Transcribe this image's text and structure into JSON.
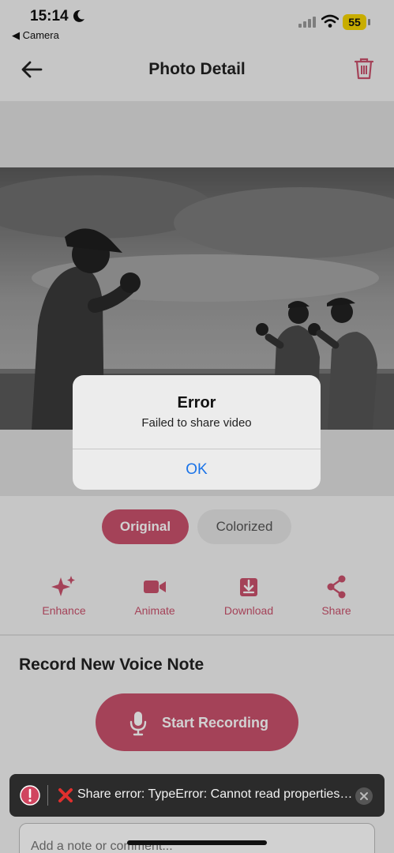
{
  "status_bar": {
    "time": "15:14",
    "back_app": "◀ Camera",
    "battery": "55"
  },
  "header": {
    "title": "Photo Detail"
  },
  "photo": {
    "description_icon": "black-and-white-photo"
  },
  "view_toggle": {
    "original_label": "Original",
    "colorized_label": "Colorized",
    "selected": "Original"
  },
  "actions": [
    {
      "label": "Enhance",
      "icon": "sparkles-icon"
    },
    {
      "label": "Animate",
      "icon": "video-camera-icon"
    },
    {
      "label": "Download",
      "icon": "download-icon"
    },
    {
      "label": "Share",
      "icon": "share-icon"
    }
  ],
  "voice_note": {
    "section_title": "Record New Voice Note",
    "record_button_label": "Start Recording"
  },
  "note": {
    "placeholder": "Add a note or comment..."
  },
  "alert": {
    "title": "Error",
    "message": "Failed to share video",
    "ok_label": "OK"
  },
  "toast": {
    "message": "Share error: TypeError: Cannot read properties of undefined"
  },
  "colors": {
    "accent": "#c9516c",
    "link_blue": "#1a73e8",
    "toast_bg": "#2b2b2b"
  }
}
